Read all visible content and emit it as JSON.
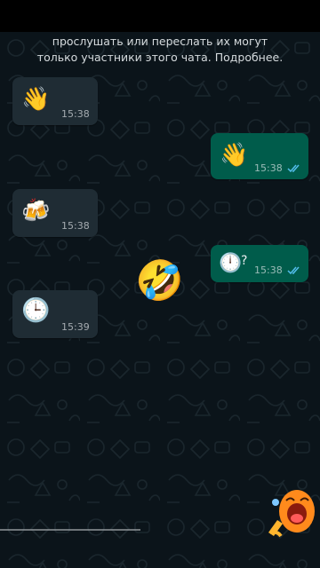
{
  "notice": {
    "line1": "прослушать или переслать их могут",
    "line2": "только участники этого чата. Подробнее."
  },
  "messages": [
    {
      "direction": "in",
      "emoji": "👋",
      "emoji_name": "waving-hand",
      "time": "15:38"
    },
    {
      "direction": "out",
      "emoji": "👋",
      "emoji_name": "waving-hand",
      "time": "15:38",
      "status": "read"
    },
    {
      "direction": "in",
      "emoji": "🍻",
      "emoji_name": "clinking-beer-mugs",
      "time": "15:38"
    },
    {
      "direction": "out",
      "emoji": "🕛",
      "emoji_name": "twelve-oclock",
      "text": "?",
      "time": "15:38",
      "status": "read"
    },
    {
      "direction": "in",
      "emoji": "🕒",
      "emoji_name": "three-oclock",
      "time": "15:39"
    }
  ],
  "floating_emoji": {
    "char": "🤣",
    "name": "rolling-on-floor-laughing"
  },
  "sticker": {
    "name": "laughing-character-sticker"
  },
  "colors": {
    "background": "#0b141a",
    "incoming_bubble": "#1f2c34",
    "outgoing_bubble": "#005c4b",
    "read_ticks": "#53bdeb"
  }
}
